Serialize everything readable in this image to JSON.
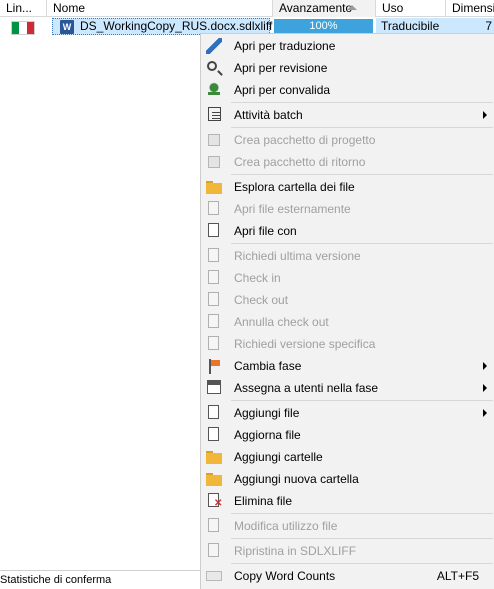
{
  "header": {
    "columns": [
      {
        "label": "Lin..."
      },
      {
        "label": "Nome"
      },
      {
        "label": "Avanzamento"
      },
      {
        "label": "Uso"
      },
      {
        "label": "Dimensi"
      }
    ]
  },
  "file_row": {
    "flag_colors": [
      "#009246",
      "#ffffff",
      "#ce2b37"
    ],
    "doc_icon_letter": "W",
    "file_name": "DS_WorkingCopy_RUS.docx.sdlxliff",
    "progress": "100%",
    "use": "Traducibile",
    "size": "7"
  },
  "status": {
    "confirm_stats": "Statistiche di conferma"
  },
  "menu": {
    "items": [
      {
        "label": "Apri per traduzione",
        "icon": "pencil-icon",
        "enabled": true
      },
      {
        "label": "Apri per revisione",
        "icon": "search-icon",
        "enabled": true
      },
      {
        "label": "Apri per convalida",
        "icon": "stamp-icon",
        "enabled": true
      },
      {
        "label": "Attività batch",
        "icon": "batch-icon",
        "enabled": true,
        "submenu": true
      },
      {
        "label": "Crea pacchetto di progetto",
        "icon": "package-icon",
        "enabled": false
      },
      {
        "label": "Crea pacchetto di ritorno",
        "icon": "return-package-icon",
        "enabled": false
      },
      {
        "label": "Esplora cartella dei file",
        "icon": "folder-icon",
        "enabled": true
      },
      {
        "label": "Apri file esternamente",
        "icon": "external-file-icon",
        "enabled": false
      },
      {
        "label": "Apri file con",
        "icon": "open-with-icon",
        "enabled": true
      },
      {
        "label": "Richiedi ultima versione",
        "icon": "latest-version-icon",
        "enabled": false
      },
      {
        "label": "Check in",
        "icon": "check-in-icon",
        "enabled": false
      },
      {
        "label": "Check out",
        "icon": "check-out-icon",
        "enabled": false
      },
      {
        "label": "Annulla check out",
        "icon": "undo-checkout-icon",
        "enabled": false
      },
      {
        "label": "Richiedi versione specifica",
        "icon": "specific-version-icon",
        "enabled": false
      },
      {
        "label": "Cambia fase",
        "icon": "flag-icon",
        "enabled": true,
        "submenu": true
      },
      {
        "label": "Assegna a utenti nella fase",
        "icon": "calendar-icon",
        "enabled": true,
        "submenu": true
      },
      {
        "label": "Aggiungi file",
        "icon": "add-file-icon",
        "enabled": true,
        "submenu": true
      },
      {
        "label": "Aggiorna file",
        "icon": "update-file-icon",
        "enabled": true
      },
      {
        "label": "Aggiungi cartelle",
        "icon": "add-folders-icon",
        "enabled": true
      },
      {
        "label": "Aggiungi nuova cartella",
        "icon": "new-folder-icon",
        "enabled": true
      },
      {
        "label": "Elimina file",
        "icon": "delete-file-icon",
        "enabled": true
      },
      {
        "label": "Modifica utilizzo file",
        "icon": "file-usage-icon",
        "enabled": false
      },
      {
        "label": "Ripristina in SDLXLIFF",
        "icon": "restore-sdlxliff-icon",
        "enabled": false
      },
      {
        "label": "Copy Word Counts",
        "icon": "word-count-icon",
        "enabled": true,
        "shortcut": "ALT+F5"
      }
    ]
  }
}
